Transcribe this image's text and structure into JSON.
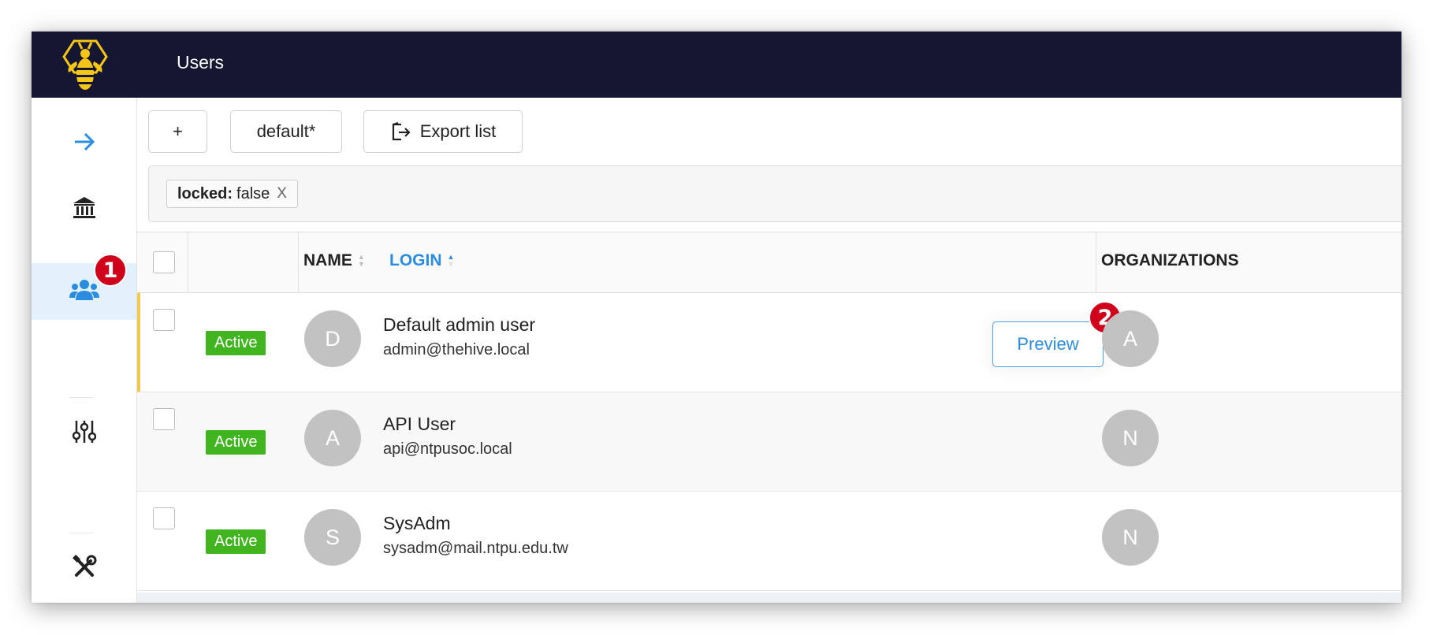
{
  "header": {
    "title": "Users"
  },
  "sidebar": {
    "badge": "1",
    "items": [
      {
        "icon": "arrow-right-icon"
      },
      {
        "icon": "bank-icon"
      },
      {
        "icon": "users-icon",
        "active": true
      },
      {
        "icon": "sliders-icon"
      },
      {
        "icon": "tools-icon"
      }
    ]
  },
  "toolbar": {
    "add_label": "+",
    "filter_preset": "default*",
    "export_label": "Export list"
  },
  "filter": {
    "key": "locked:",
    "value": "false",
    "remove": "X"
  },
  "table": {
    "columns": {
      "name": "NAME",
      "login": "LOGIN",
      "organizations": "ORGANIZATIONS"
    },
    "preview_label": "Preview",
    "preview_badge": "2",
    "rows": [
      {
        "status": "Active",
        "initial": "D",
        "name": "Default admin user",
        "login": "admin@thehive.local",
        "org_initial": "A"
      },
      {
        "status": "Active",
        "initial": "A",
        "name": "API User",
        "login": "api@ntpusoc.local",
        "org_initial": "N"
      },
      {
        "status": "Active",
        "initial": "S",
        "name": "SysAdm",
        "login": "sysadm@mail.ntpu.edu.tw",
        "org_initial": "N"
      }
    ]
  },
  "colors": {
    "topbar": "#151631",
    "accent": "#2b8de0",
    "active_status": "#40b51f",
    "badge": "#d0021b",
    "selected_row": "#f2c94c"
  }
}
